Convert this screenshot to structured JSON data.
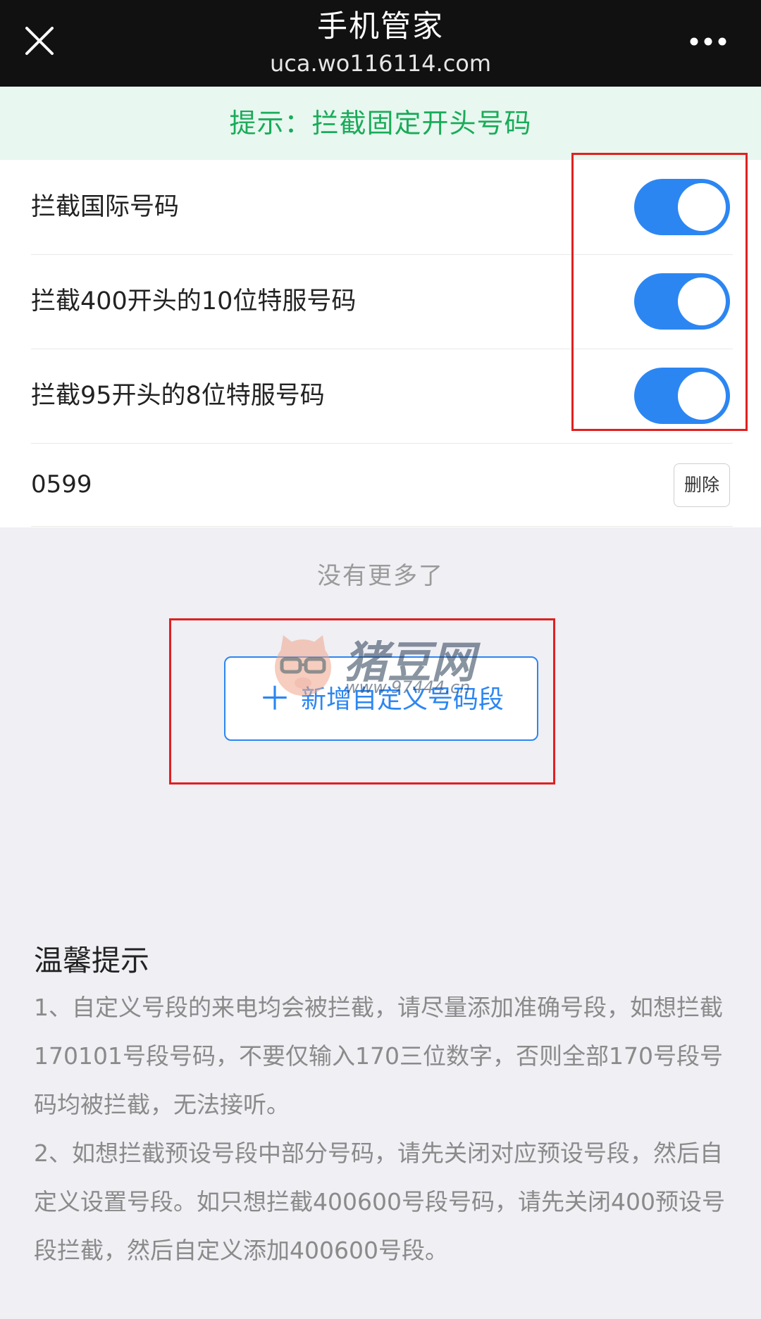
{
  "header": {
    "title": "手机管家",
    "url": "uca.wo116114.com"
  },
  "tip": "提示：拦截固定开头号码",
  "presets": [
    {
      "label": "拦截国际号码",
      "enabled": true
    },
    {
      "label": "拦截400开头的10位特服号码",
      "enabled": true
    },
    {
      "label": "拦截95开头的8位特服号码",
      "enabled": true
    }
  ],
  "custom": {
    "number": "0599",
    "delete_label": "删除"
  },
  "no_more": "没有更多了",
  "add_button": {
    "icon": "plus-icon",
    "label": "新增自定义号码段"
  },
  "watermark": {
    "text": "猪豆网",
    "url": "www.97444.cn"
  },
  "notes": {
    "title": "温馨提示",
    "items": [
      "1、自定义号段的来电均会被拦截，请尽量添加准确号段，如想拦截170101号段号码，不要仅输入170三位数字，否则全部170号段号码均被拦截，无法接听。",
      "2、如想拦截预设号段中部分号码，请先关闭对应预设号段，然后自定义设置号段。如只想拦截400600号段号码，请先关闭400预设号段拦截，然后自定义添加400600号段。"
    ]
  },
  "colors": {
    "accent": "#2c86f2",
    "tip_green": "#1aab5a",
    "annotation_red": "#e02020"
  }
}
